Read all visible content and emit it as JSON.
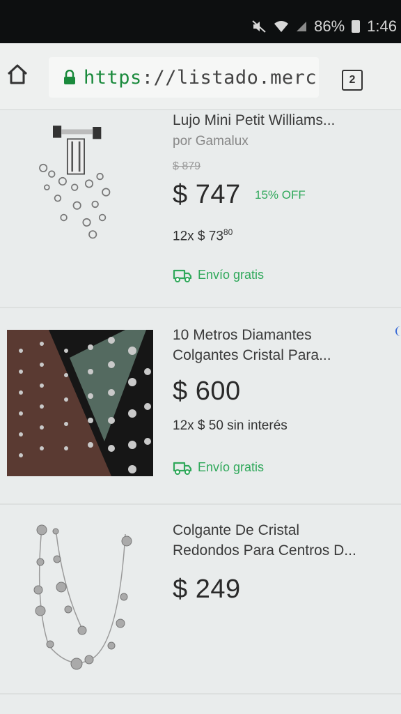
{
  "status_bar": {
    "battery": "86%",
    "time": "1:46",
    "icons": [
      "mute-icon",
      "wifi-icon",
      "signal-icon",
      "battery-icon"
    ]
  },
  "browser": {
    "url_scheme": "https",
    "url_rest": "://listado.merc",
    "tab_count": "2",
    "icons": [
      "home-icon",
      "lock-icon"
    ]
  },
  "listings": [
    {
      "title": "Lujo Mini Petit Williams...",
      "seller": "por Gamalux",
      "old_price": "$ 879",
      "price": "$ 747",
      "discount": "15% OFF",
      "installments_prefix": "12x $ 73",
      "installments_cents": "80",
      "shipping": "Envío gratis"
    },
    {
      "title_line1": "10 Metros Diamantes",
      "title_line2": "Colgantes Cristal Para...",
      "price": "$ 600",
      "installments": "12x $ 50 sin interés",
      "shipping": "Envío gratis"
    },
    {
      "title_line1": "Colgante De Cristal",
      "title_line2": "Redondos Para Centros D...",
      "price": "$ 249"
    }
  ],
  "colors": {
    "accent_green": "#2fa85a",
    "https_green": "#1a8a3c",
    "page_background": "#e9ecec"
  }
}
